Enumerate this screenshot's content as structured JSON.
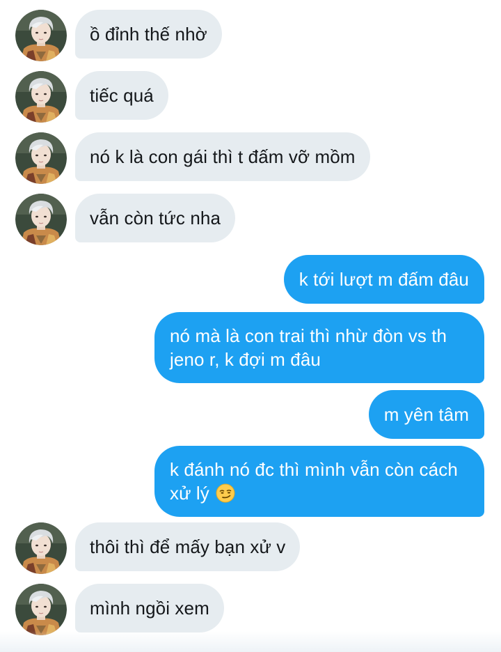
{
  "messages": [
    {
      "side": "in",
      "text": "ồ đỉnh thế nhờ"
    },
    {
      "side": "in",
      "text": "tiếc quá"
    },
    {
      "side": "in",
      "text": "nó k là con gái thì t đấm vỡ mồm"
    },
    {
      "side": "in",
      "text": "vẫn còn tức nha"
    },
    {
      "side": "out",
      "text": "k tới lượt m đấm đâu"
    },
    {
      "side": "out",
      "text": "nó mà là con trai thì nhừ đòn vs th jeno r, k đợi m đâu"
    },
    {
      "side": "out",
      "text": "m yên tâm"
    },
    {
      "side": "out",
      "text": "k đánh nó đc thì mình vẫn còn cách xử lý",
      "emoji": "smirking-face"
    },
    {
      "side": "in",
      "text": "thôi thì để mấy bạn xử v"
    },
    {
      "side": "in",
      "text": "mình ngồi xem"
    }
  ],
  "colors": {
    "incoming_bubble": "#e6ecf0",
    "outgoing_bubble": "#1da1f2",
    "incoming_text": "#14171a",
    "outgoing_text": "#ffffff"
  }
}
